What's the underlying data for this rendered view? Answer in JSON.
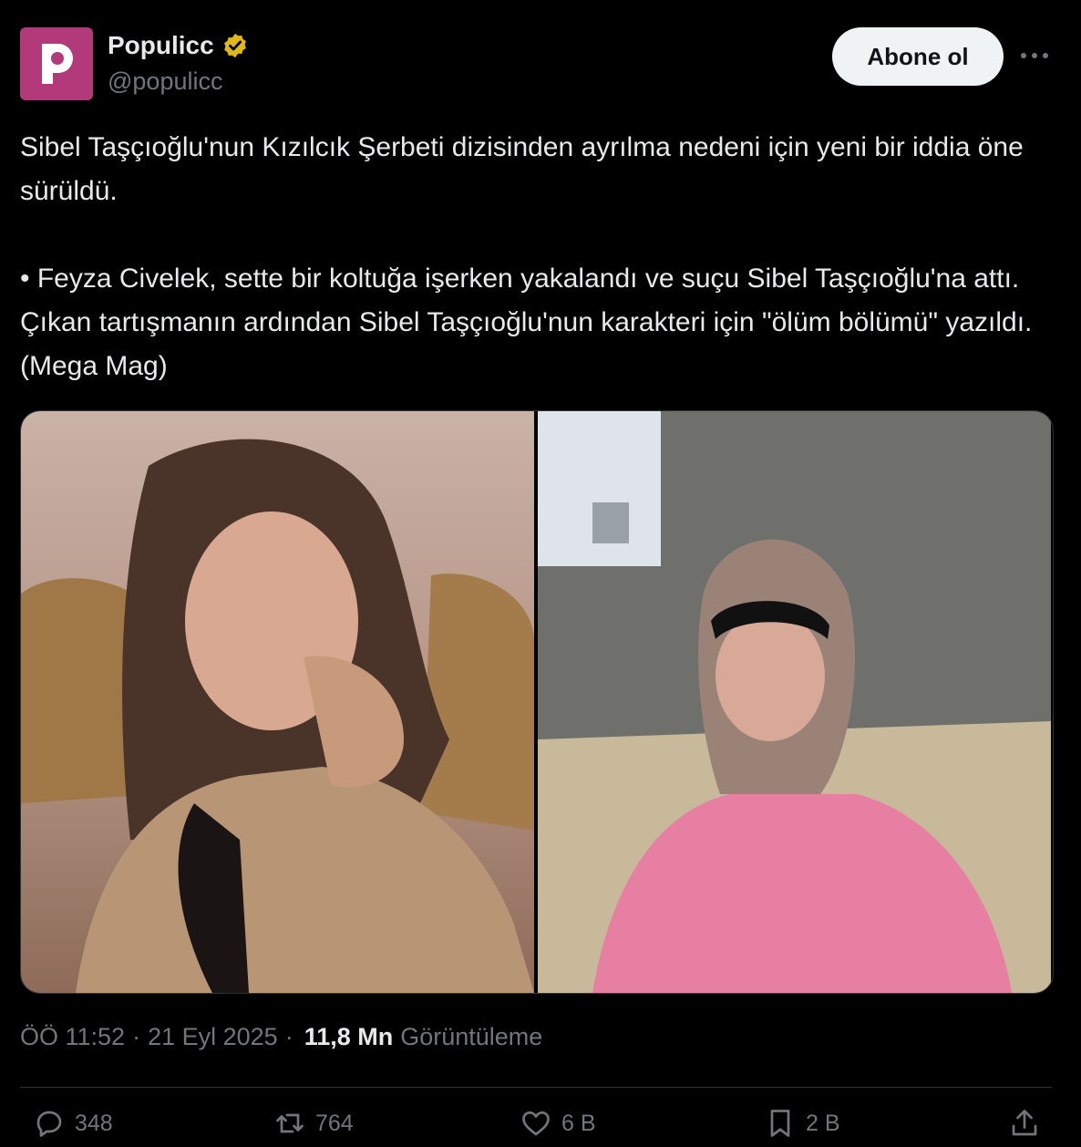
{
  "account": {
    "display_name": "Populicc",
    "handle": "@populicc",
    "avatar_letter": "P",
    "avatar_color": "#b23a7a",
    "verified_badge": "verified-gold-icon"
  },
  "follow_label": "Abone ol",
  "tweet": {
    "line1": "Sibel Taşçıoğlu'nun Kızılcık Şerbeti dizisinden ayrılma nedeni için yeni bir iddia öne sürüldü.",
    "line2": "• Feyza Civelek, sette bir koltuğa işerken yakalandı ve suçu Sibel Taşçıoğlu'na attı. Çıkan tartışmanın ardından Sibel Taşçıoğlu'nun karakteri için \"ölüm bölümü\" yazıldı. (Mega Mag)"
  },
  "meta": {
    "time": "ÖÖ 11:52",
    "sep1": "·",
    "date": "21 Eyl 2025",
    "sep2": "·",
    "views": "11,8 Mn",
    "views_label": "Görüntüleme"
  },
  "actions": {
    "replies": "348",
    "reposts": "764",
    "likes": "6 B",
    "bookmarks": "2 B"
  },
  "colors": {
    "background": "#000000",
    "text": "#e7e9ea",
    "secondary": "#71767b",
    "verified": "#e2b719"
  }
}
